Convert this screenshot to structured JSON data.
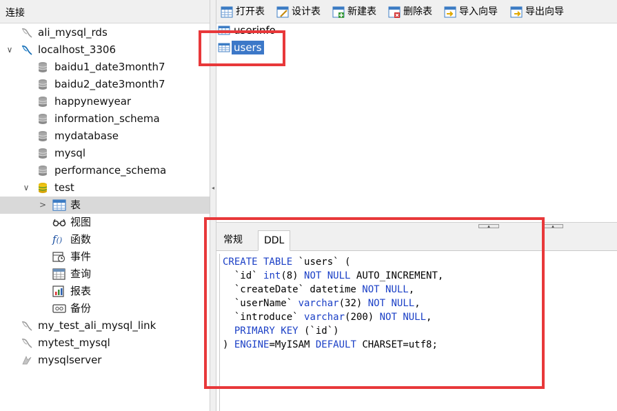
{
  "sidebar": {
    "header": "连接",
    "items": [
      {
        "label": "ali_mysql_rds",
        "type": "connection"
      },
      {
        "label": "localhost_3306",
        "type": "connection",
        "expanded": true
      },
      {
        "label": "baidu1_date3month7",
        "type": "database"
      },
      {
        "label": "baidu2_date3month7",
        "type": "database"
      },
      {
        "label": "happynewyear",
        "type": "database"
      },
      {
        "label": "information_schema",
        "type": "database"
      },
      {
        "label": "mydatabase",
        "type": "database"
      },
      {
        "label": "mysql",
        "type": "database"
      },
      {
        "label": "performance_schema",
        "type": "database"
      },
      {
        "label": "test",
        "type": "database",
        "expanded": true
      },
      {
        "label": "表",
        "type": "tables-node",
        "selected": true
      },
      {
        "label": "视图",
        "type": "views-node"
      },
      {
        "label": "函数",
        "type": "functions-node"
      },
      {
        "label": "事件",
        "type": "events-node"
      },
      {
        "label": "查询",
        "type": "queries-node"
      },
      {
        "label": "报表",
        "type": "reports-node"
      },
      {
        "label": "备份",
        "type": "backups-node"
      },
      {
        "label": "my_test_ali_mysql_link",
        "type": "connection"
      },
      {
        "label": "mytest_mysql",
        "type": "connection"
      },
      {
        "label": "mysqlserver",
        "type": "connection"
      }
    ]
  },
  "toolbar": {
    "open_table": "打开表",
    "design_table": "设计表",
    "new_table": "新建表",
    "delete_table": "删除表",
    "import_wizard": "导入向导",
    "export_wizard": "导出向导"
  },
  "table_list": {
    "items": [
      {
        "label": "userinfo",
        "selected": false
      },
      {
        "label": "users",
        "selected": true
      }
    ]
  },
  "tabs": {
    "general": "常规",
    "ddl": "DDL"
  },
  "ddl": {
    "line1_a": "CREATE TABLE",
    "line1_b": " `users` (",
    "line2_a": "  `id` ",
    "line2_b": "int",
    "line2_c": "(8) ",
    "line2_d": "NOT NULL",
    "line2_e": " AUTO_INCREMENT,",
    "line3_a": "  `createDate` datetime ",
    "line3_b": "NOT NULL",
    "line3_c": ",",
    "line4_a": "  `userName` ",
    "line4_b": "varchar",
    "line4_c": "(32) ",
    "line4_d": "NOT NULL",
    "line4_e": ",",
    "line5_a": "  `introduce` ",
    "line5_b": "varchar",
    "line5_c": "(200) ",
    "line5_d": "NOT NULL",
    "line5_e": ",",
    "line6_a": "  PRIMARY KEY",
    "line6_b": " (`id`)",
    "line7_a": ") ",
    "line7_b": "ENGINE",
    "line7_c": "=MyISAM ",
    "line7_d": "DEFAULT",
    "line7_e": " CHARSET=utf8;"
  },
  "colors": {
    "highlight": "#e8383a",
    "keyword": "#1a3fc6",
    "selection": "#3c78c8"
  }
}
